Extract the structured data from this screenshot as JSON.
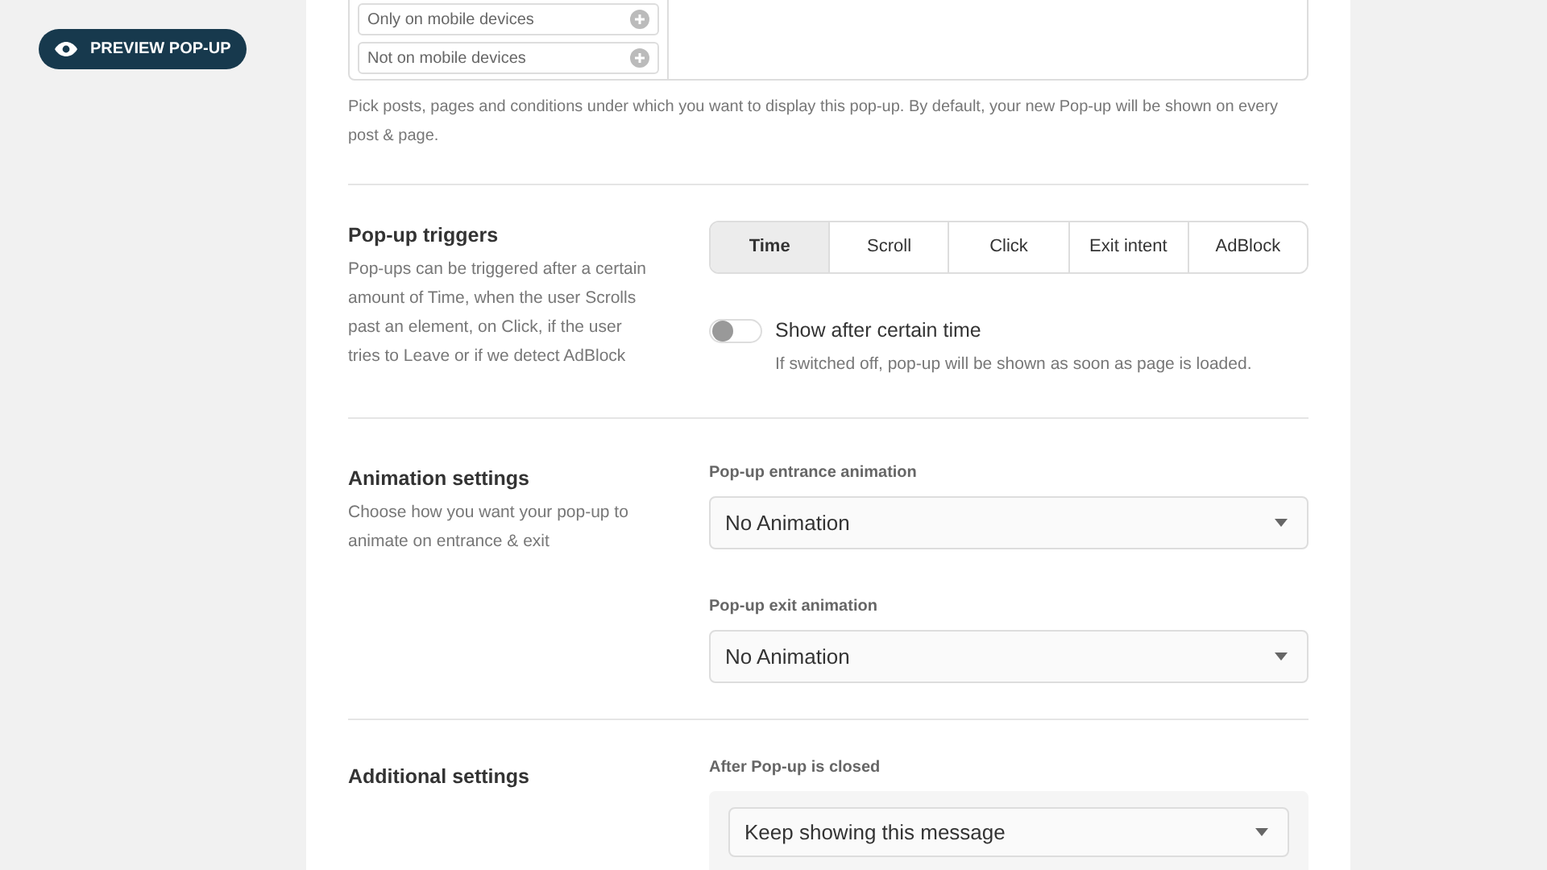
{
  "preview_button": {
    "label": "PREVIEW POP-UP"
  },
  "visibility": {
    "conditions": [
      {
        "label": "Only on mobile devices"
      },
      {
        "label": "Not on mobile devices"
      }
    ],
    "description": "Pick posts, pages and conditions under which you want to display this pop-up. By default, your new Pop-up will be shown on every post & page."
  },
  "triggers": {
    "title": "Pop-up triggers",
    "description": "Pop-ups can be triggered after a certain amount of Time, when the user Scrolls past an element, on Click, if the user tries to Leave or if we detect AdBlock",
    "tabs": [
      {
        "label": "Time",
        "selected": true
      },
      {
        "label": "Scroll",
        "selected": false
      },
      {
        "label": "Click",
        "selected": false
      },
      {
        "label": "Exit intent",
        "selected": false
      },
      {
        "label": "AdBlock",
        "selected": false
      }
    ],
    "toggle": {
      "label": "Show after certain time",
      "on": false,
      "hint": "If switched off, pop-up will be shown as soon as page is loaded."
    }
  },
  "animation": {
    "title": "Animation settings",
    "description": "Choose how you want your pop-up to animate on entrance & exit",
    "fields": [
      {
        "label": "Pop-up entrance animation",
        "value": "No Animation"
      },
      {
        "label": "Pop-up exit animation",
        "value": "No Animation"
      }
    ]
  },
  "additional": {
    "title": "Additional settings",
    "fields": [
      {
        "label": "After Pop-up is closed",
        "value": "Keep showing this message"
      }
    ]
  }
}
